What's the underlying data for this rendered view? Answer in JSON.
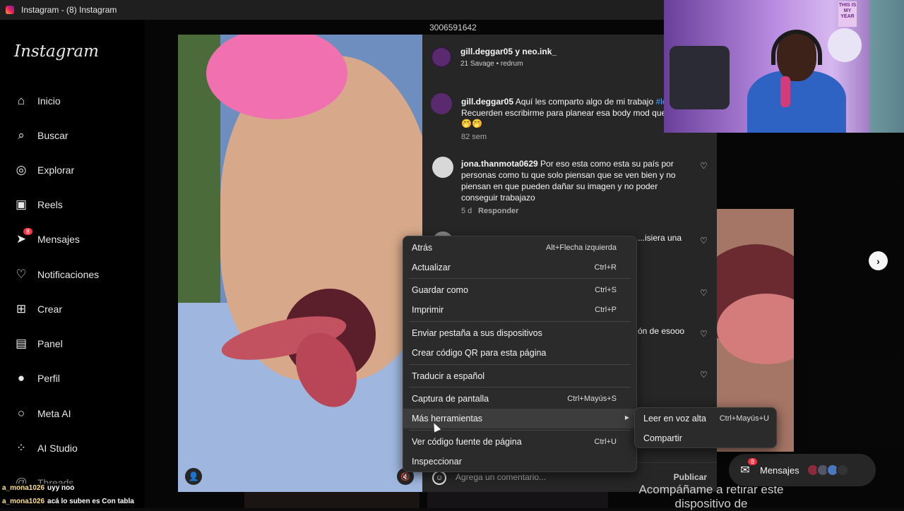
{
  "window": {
    "title": "Instagram - (8) Instagram"
  },
  "sidebar": {
    "logo": "Instagram",
    "items": [
      {
        "label": "Inicio",
        "icon": "home-icon",
        "glyph": "⌂"
      },
      {
        "label": "Buscar",
        "icon": "search-icon",
        "glyph": "⌕"
      },
      {
        "label": "Explorar",
        "icon": "compass-icon",
        "glyph": "◎"
      },
      {
        "label": "Reels",
        "icon": "reels-icon",
        "glyph": "▣"
      },
      {
        "label": "Mensajes",
        "icon": "messenger-icon",
        "glyph": "➤",
        "badge": "8"
      },
      {
        "label": "Notificaciones",
        "icon": "heart-icon",
        "glyph": "♡"
      },
      {
        "label": "Crear",
        "icon": "plus-square-icon",
        "glyph": "⊞"
      },
      {
        "label": "Panel",
        "icon": "chart-icon",
        "glyph": "▤"
      },
      {
        "label": "Perfil",
        "icon": "avatar-icon",
        "glyph": "●"
      },
      {
        "label": "Meta AI",
        "icon": "meta-ai-icon",
        "glyph": "○"
      },
      {
        "label": "AI Studio",
        "icon": "ai-studio-icon",
        "glyph": "⁘"
      },
      {
        "label": "Threads",
        "icon": "threads-icon",
        "glyph": "@"
      }
    ]
  },
  "post": {
    "phone_number": "3006591642",
    "author": "gill.deggar05 y neo.ink_",
    "author_sub": "21 Savage • redrum",
    "comments": [
      {
        "user": "gill.deggar05",
        "text": "Aquí les comparto algo de mi trabajo",
        "hashtag": "#le",
        "line2": "Recuerden escribirme para planear esa body mod que t",
        "emojis": "🤭🤭",
        "age": "82 sem",
        "reply": ""
      },
      {
        "user": "jona.thanmota0629",
        "text": "Por eso esta como esta su país por personas como tu que solo piensan que se ven bien y no piensan en que pueden dañar su imagen y no poder conseguir trabajazo",
        "age": "5 d",
        "reply": "Responder"
      },
      {
        "user": "",
        "text": "...isiera una"
      },
      {
        "user": "",
        "text": "ón de esooo"
      }
    ],
    "composer_placeholder": "Agrega un comentario...",
    "publish_label": "Publicar"
  },
  "context_menu": {
    "items": [
      {
        "label": "Atrás",
        "shortcut": "Alt+Flecha izquierda"
      },
      {
        "label": "Actualizar",
        "shortcut": "Ctrl+R"
      },
      {
        "label": "Guardar como",
        "shortcut": "Ctrl+S"
      },
      {
        "label": "Imprimir",
        "shortcut": "Ctrl+P"
      },
      {
        "label": "Enviar pestaña a sus dispositivos",
        "shortcut": ""
      },
      {
        "label": "Crear código QR para esta página",
        "shortcut": ""
      },
      {
        "label": "Traducir a español",
        "shortcut": ""
      },
      {
        "label": "Captura de pantalla",
        "shortcut": "Ctrl+Mayús+S"
      },
      {
        "label": "Más herramientas",
        "shortcut": ""
      },
      {
        "label": "Ver código fuente de página",
        "shortcut": "Ctrl+U"
      },
      {
        "label": "Inspeccionar",
        "shortcut": ""
      }
    ],
    "submenu": [
      {
        "label": "Leer en voz alta",
        "shortcut": "Ctrl+Mayús+U"
      },
      {
        "label": "Compartir",
        "shortcut": ""
      }
    ]
  },
  "messages_pill": {
    "label": "Mensajes",
    "badge": "8"
  },
  "background_caption": "Acompáñame a retirar este dispositivo de",
  "webcam": {
    "sign_text": "THIS IS MY YEAR"
  },
  "chat": [
    {
      "user": "a_mona1026",
      "text": "uyy noo"
    },
    {
      "user": "a_mona1026",
      "text": "acá lo suben es Con tabla"
    }
  ]
}
